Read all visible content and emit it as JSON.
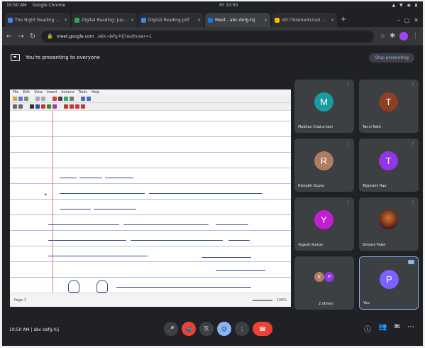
{
  "os": {
    "time_left": "10:50 AM",
    "app_name": "Google Chrome",
    "time_center": "Fri 10:50",
    "status_icons": "▲ ▼ ◉ ▮"
  },
  "browser": {
    "tabs": [
      {
        "label": "The Night Reading Assi…",
        "color": "#4285f4"
      },
      {
        "label": "Digital Reading: Jupy…",
        "color": "#34a853"
      },
      {
        "label": "Digital Reading.pdf",
        "color": "#4285f4"
      },
      {
        "label": "Meet - abc-defg-hij",
        "color": "#1a73e8"
      },
      {
        "label": "VD (Telemedicine) …",
        "color": "#fbbc04"
      }
    ],
    "new_tab": "+",
    "window_controls": [
      "–",
      "▢",
      "✕"
    ],
    "address_host": "meet.google.com",
    "address_path": "/abc-defg-hij?authuser=1"
  },
  "meet": {
    "presenting_label": "You're presenting to everyone",
    "stop_presenting": "Stop presenting",
    "meeting_code": "10:50 AM  |  abc-defg-hij",
    "participants": [
      {
        "initial": "M",
        "name": "Madhav Chaturvedi",
        "color": "#1a9ba1"
      },
      {
        "initial": "T",
        "name": "Tanvi Rath",
        "color": "#8d3f1f"
      },
      {
        "initial": "R",
        "name": "Rishabh Gupta",
        "color": "#b07c62"
      },
      {
        "initial": "T",
        "name": "Tejaswini Rao",
        "color": "#9334e6"
      },
      {
        "initial": "Y",
        "name": "Yogesh Kumar",
        "color": "#c21fd1"
      },
      {
        "initial": "",
        "name": "Shivani Patel",
        "color": "#000000"
      },
      {
        "initial": "K",
        "name": "2 others",
        "color": "#b07c62",
        "initial2": "P",
        "color2": "#9334e6"
      },
      {
        "initial": "P",
        "name": "You",
        "color": "#7b61ff"
      }
    ],
    "controls": [
      "🎤",
      "📹",
      "⎘",
      "☺",
      "⋮"
    ],
    "right_controls": [
      "ⓘ",
      "👥",
      "✉",
      "⋯"
    ],
    "participant_count": "9"
  },
  "doc": {
    "menu": [
      "File",
      "Edit",
      "View",
      "Insert",
      "Actions",
      "Tools",
      "Help"
    ],
    "zoom": "100%",
    "page": "Page 1"
  }
}
